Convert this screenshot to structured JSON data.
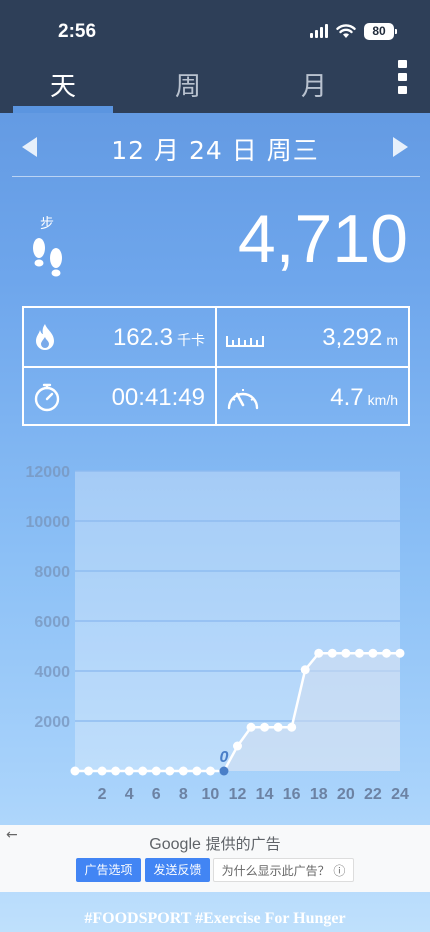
{
  "status": {
    "time": "2:56",
    "battery": "80"
  },
  "tabs": [
    {
      "label": "天",
      "active": true
    },
    {
      "label": "周"
    },
    {
      "label": "月"
    }
  ],
  "date": "12 月 24 日 周三",
  "steps": {
    "label": "步",
    "value": "4,710"
  },
  "stats": {
    "calories": {
      "value": "162.3",
      "unit": "千卡"
    },
    "distance": {
      "value": "3,292",
      "unit": "m"
    },
    "duration": {
      "value": "00:41:49"
    },
    "speed": {
      "value": "4.7",
      "unit": "km/h"
    }
  },
  "chart_data": {
    "type": "line",
    "yticks": [
      "12000",
      "10000",
      "8000",
      "6000",
      "4000",
      "2000"
    ],
    "ylim": [
      0,
      12000
    ],
    "xticks": [
      "2",
      "4",
      "6",
      "8",
      "10",
      "12",
      "14",
      "16",
      "18",
      "20",
      "22",
      "24"
    ],
    "xlim": [
      0,
      24
    ],
    "x": [
      0,
      1,
      2,
      3,
      4,
      5,
      6,
      7,
      8,
      9,
      10,
      11,
      12,
      13,
      14,
      15,
      16,
      17,
      18,
      19,
      20,
      21,
      22,
      23,
      24
    ],
    "values": [
      0,
      0,
      0,
      0,
      0,
      0,
      0,
      0,
      0,
      0,
      0,
      0,
      1000,
      1750,
      1750,
      1750,
      1750,
      4050,
      4710,
      4710,
      4710,
      4710,
      4710,
      4710,
      4710
    ],
    "highlight": {
      "x": 11,
      "label": "0"
    },
    "colors": {
      "line": "#ffffff",
      "area": "#d2dff0",
      "highlight": "#4a7fc8"
    }
  },
  "ad": {
    "brand": "Google",
    "title_suffix": "提供的广告",
    "back": "←",
    "buttons": [
      "广告选项",
      "发送反馈",
      "为什么显示此广告？"
    ],
    "info": "ⓘ"
  },
  "footer": "#FOODSPORT #Exercise For Hunger"
}
